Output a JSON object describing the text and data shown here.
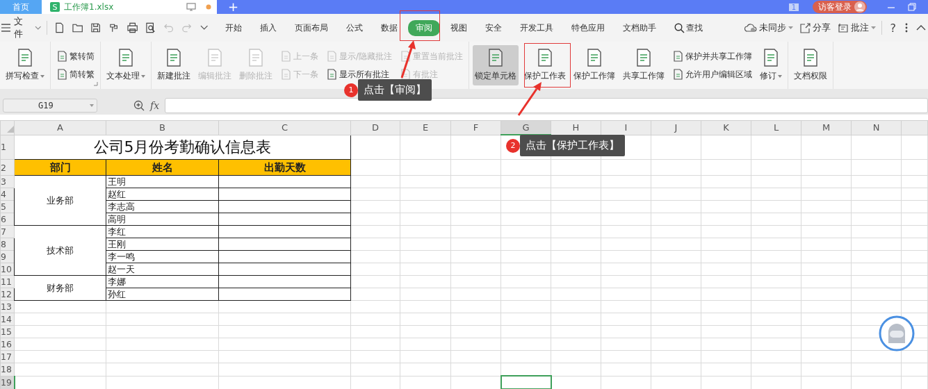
{
  "tabs": [
    {
      "label": "首页",
      "selected": false
    },
    {
      "label": "工作簿1.xlsx",
      "selected": true,
      "app_letter": "S"
    }
  ],
  "new_tab": "+",
  "title_bar": {
    "badge": "1",
    "login": "访客登录"
  },
  "menu": {
    "file": "文件",
    "items": [
      {
        "label": "开始",
        "selected": false,
        "highlighted": false
      },
      {
        "label": "插入",
        "selected": false,
        "highlighted": false
      },
      {
        "label": "页面布局",
        "selected": false,
        "highlighted": false
      },
      {
        "label": "公式",
        "selected": false,
        "highlighted": false
      },
      {
        "label": "数据",
        "selected": false,
        "highlighted": false
      },
      {
        "label": "审阅",
        "selected": true,
        "highlighted": true
      },
      {
        "label": "视图",
        "selected": false,
        "highlighted": false
      },
      {
        "label": "安全",
        "selected": false,
        "highlighted": false
      },
      {
        "label": "开发工具",
        "selected": false,
        "highlighted": false
      },
      {
        "label": "特色应用",
        "selected": false,
        "highlighted": false
      },
      {
        "label": "文档助手",
        "selected": false,
        "highlighted": false
      }
    ],
    "search": "查找",
    "sync": "未同步",
    "share": "分享",
    "comment": "批注",
    "help": "?"
  },
  "ribbon": [
    {
      "items": [
        {
          "kind": "large",
          "label": "拼写检查",
          "disabled": false,
          "pressed": false,
          "dropdown": true,
          "highlighted": false
        }
      ]
    },
    {
      "launcher": true,
      "items": [
        {
          "kind": "stack",
          "items": [
            {
              "label": "繁转简",
              "disabled": false
            },
            {
              "label": "简转繁",
              "disabled": false
            }
          ]
        }
      ]
    },
    {
      "items": [
        {
          "kind": "large",
          "label": "文本处理",
          "disabled": false,
          "pressed": false,
          "dropdown": true,
          "highlighted": false
        }
      ]
    },
    {
      "items": [
        {
          "kind": "large",
          "label": "新建批注",
          "disabled": false,
          "pressed": false,
          "dropdown": false,
          "highlighted": false
        },
        {
          "kind": "large",
          "label": "编辑批注",
          "disabled": true,
          "pressed": false,
          "dropdown": false,
          "highlighted": false
        },
        {
          "kind": "large",
          "label": "删除批注",
          "disabled": true,
          "pressed": false,
          "dropdown": false,
          "highlighted": false
        },
        {
          "kind": "stack",
          "items": [
            {
              "label": "上一条",
              "disabled": true
            },
            {
              "label": "下一条",
              "disabled": true
            }
          ]
        },
        {
          "kind": "stack",
          "items": [
            {
              "label": "显示/隐藏批注",
              "disabled": true
            },
            {
              "label": "显示所有批注",
              "disabled": false
            }
          ]
        },
        {
          "kind": "stack",
          "items": [
            {
              "label": "重置当前批注",
              "disabled": true
            },
            {
              "label": "有批注",
              "disabled": true
            }
          ]
        }
      ]
    },
    {
      "items": [
        {
          "kind": "large",
          "label": "锁定单元格",
          "disabled": false,
          "pressed": true,
          "dropdown": false,
          "highlighted": false
        },
        {
          "kind": "large",
          "label": "保护工作表",
          "disabled": false,
          "pressed": false,
          "dropdown": false,
          "highlighted": true
        },
        {
          "kind": "large",
          "label": "保护工作簿",
          "disabled": false,
          "pressed": false,
          "dropdown": false,
          "highlighted": false
        },
        {
          "kind": "large",
          "label": "共享工作簿",
          "disabled": false,
          "pressed": false,
          "dropdown": false,
          "highlighted": false
        },
        {
          "kind": "stack",
          "items": [
            {
              "label": "保护并共享工作簿",
              "disabled": false
            },
            {
              "label": "允许用户编辑区域",
              "disabled": false
            }
          ]
        },
        {
          "kind": "large",
          "label": "修订",
          "disabled": false,
          "pressed": false,
          "dropdown": true,
          "highlighted": false
        }
      ]
    },
    {
      "items": [
        {
          "kind": "large",
          "label": "文档权限",
          "disabled": false,
          "pressed": false,
          "dropdown": false,
          "highlighted": false
        }
      ]
    }
  ],
  "formula_bar": {
    "name_box": "G19",
    "fx_label": "fx"
  },
  "sheet": {
    "columns": [
      {
        "label": "A",
        "selected": false
      },
      {
        "label": "B",
        "selected": false
      },
      {
        "label": "C",
        "selected": false
      },
      {
        "label": "D",
        "selected": false
      },
      {
        "label": "E",
        "selected": false
      },
      {
        "label": "F",
        "selected": false
      },
      {
        "label": "G",
        "selected": true
      },
      {
        "label": "H",
        "selected": false
      },
      {
        "label": "I",
        "selected": false
      },
      {
        "label": "J",
        "selected": false
      },
      {
        "label": "K",
        "selected": false
      },
      {
        "label": "L",
        "selected": false
      },
      {
        "label": "M",
        "selected": false
      },
      {
        "label": "N",
        "selected": false
      }
    ],
    "rows": [
      {
        "label": "1",
        "selected": false
      },
      {
        "label": "2",
        "selected": false
      },
      {
        "label": "3",
        "selected": false
      },
      {
        "label": "4",
        "selected": false
      },
      {
        "label": "5",
        "selected": false
      },
      {
        "label": "6",
        "selected": false
      },
      {
        "label": "7",
        "selected": false
      },
      {
        "label": "8",
        "selected": false
      },
      {
        "label": "9",
        "selected": false
      },
      {
        "label": "10",
        "selected": false
      },
      {
        "label": "11",
        "selected": false
      },
      {
        "label": "12",
        "selected": false
      },
      {
        "label": "13",
        "selected": false
      },
      {
        "label": "14",
        "selected": false
      },
      {
        "label": "15",
        "selected": false
      },
      {
        "label": "16",
        "selected": false
      },
      {
        "label": "17",
        "selected": false
      },
      {
        "label": "18",
        "selected": false
      },
      {
        "label": "19",
        "selected": true
      }
    ],
    "title": "公司5月份考勤确认信息表",
    "headers": [
      "部门",
      "姓名",
      "出勤天数"
    ],
    "groups": [
      {
        "department": "业务部",
        "names": [
          "王明",
          "赵红",
          "李志高",
          "高明"
        ]
      },
      {
        "department": "技术部",
        "names": [
          "李红",
          "王刚",
          "李一鸣",
          "赵一天"
        ]
      },
      {
        "department": "财务部",
        "names": [
          "李娜",
          "孙红"
        ]
      }
    ]
  },
  "callouts": [
    {
      "number": "1",
      "text": "点击【审阅】"
    },
    {
      "number": "2",
      "text": "点击【保护工作表】"
    }
  ]
}
